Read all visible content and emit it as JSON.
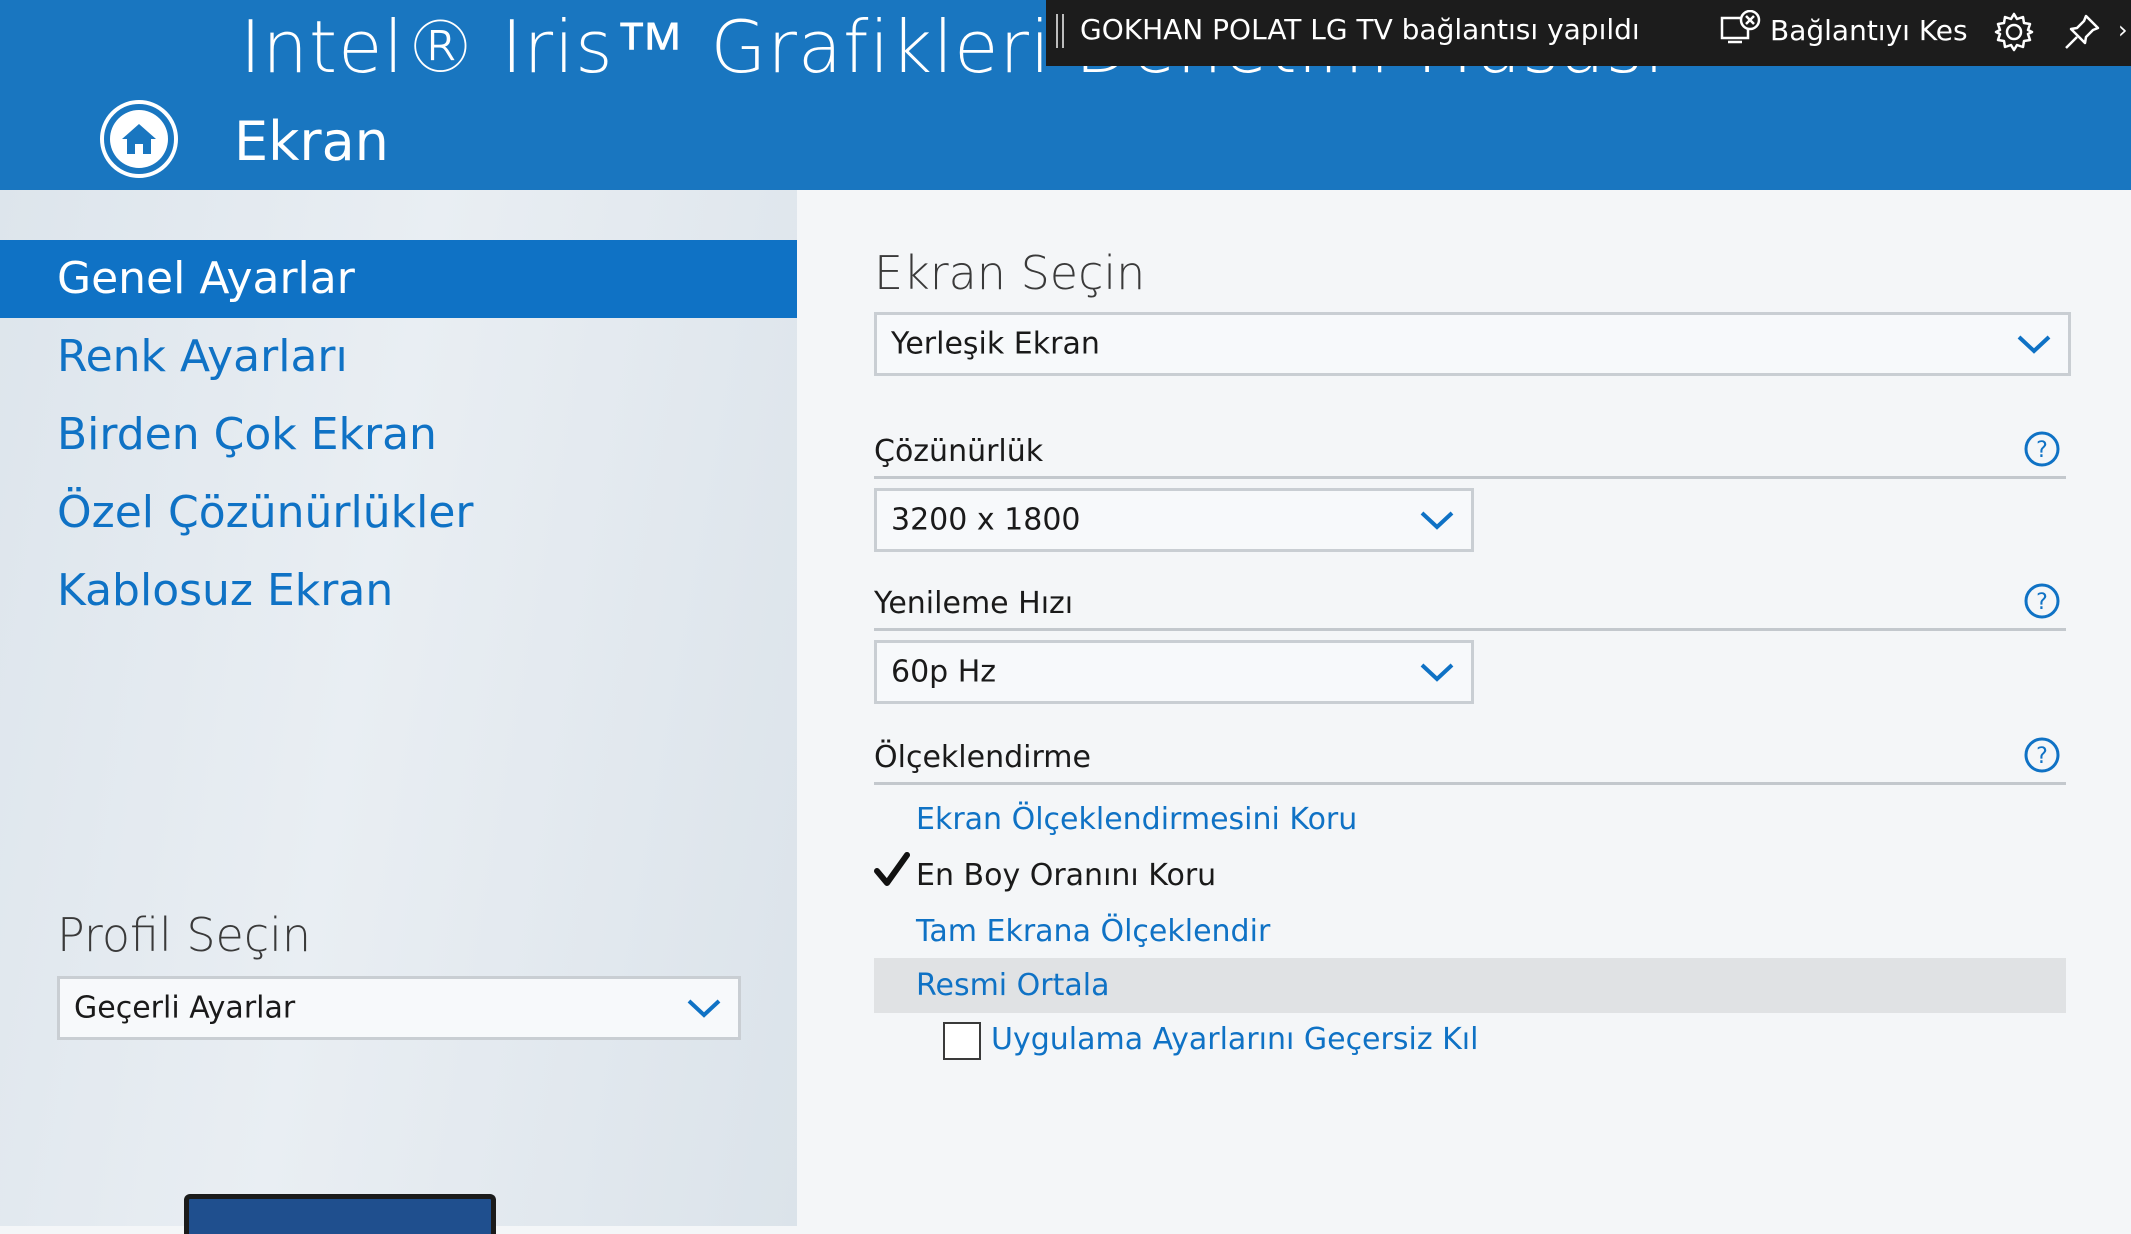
{
  "header": {
    "app_title": "Intel® Iris™ Grafikleri Denetim Masası",
    "section_title": "Ekran",
    "home_icon": "home-icon"
  },
  "cast_banner": {
    "message": "GOKHAN POLAT LG TV bağlantısı yapıldı",
    "disconnect_label": "Bağlantıyı Kes",
    "disconnect_icon": "disconnect-screen-icon",
    "settings_icon": "gear-icon",
    "pin_icon": "pin-icon"
  },
  "sidebar": {
    "items": [
      {
        "label": "Genel Ayarlar",
        "active": true
      },
      {
        "label": "Renk Ayarları",
        "active": false
      },
      {
        "label": "Birden Çok Ekran",
        "active": false
      },
      {
        "label": "Özel Çözünürlükler",
        "active": false
      },
      {
        "label": "Kablosuz Ekran",
        "active": false
      }
    ],
    "profile": {
      "label": "Profil Seçin",
      "selected": "Geçerli Ayarlar"
    }
  },
  "main": {
    "display_select": {
      "heading": "Ekran Seçin",
      "selected": "Yerleşik Ekran"
    },
    "resolution": {
      "label": "Çözünürlük",
      "selected": "3200 x 1800"
    },
    "refresh_rate": {
      "label": "Yenileme Hızı",
      "selected": "60p Hz"
    },
    "scaling": {
      "label": "Ölçeklendirme",
      "options": [
        {
          "label": "Ekran Ölçeklendirmesini Koru",
          "selected": false
        },
        {
          "label": "En Boy Oranını Koru",
          "selected": true
        },
        {
          "label": "Tam Ekrana Ölçeklendir",
          "selected": false
        },
        {
          "label": "Resmi Ortala",
          "selected": false
        }
      ],
      "override_label": "Uygulama Ayarlarını Geçersiz Kıl",
      "override_checked": false
    }
  },
  "colors": {
    "accent": "#0f72c5",
    "header_bg": "#1976c0",
    "banner_bg": "#1c1c1c"
  }
}
